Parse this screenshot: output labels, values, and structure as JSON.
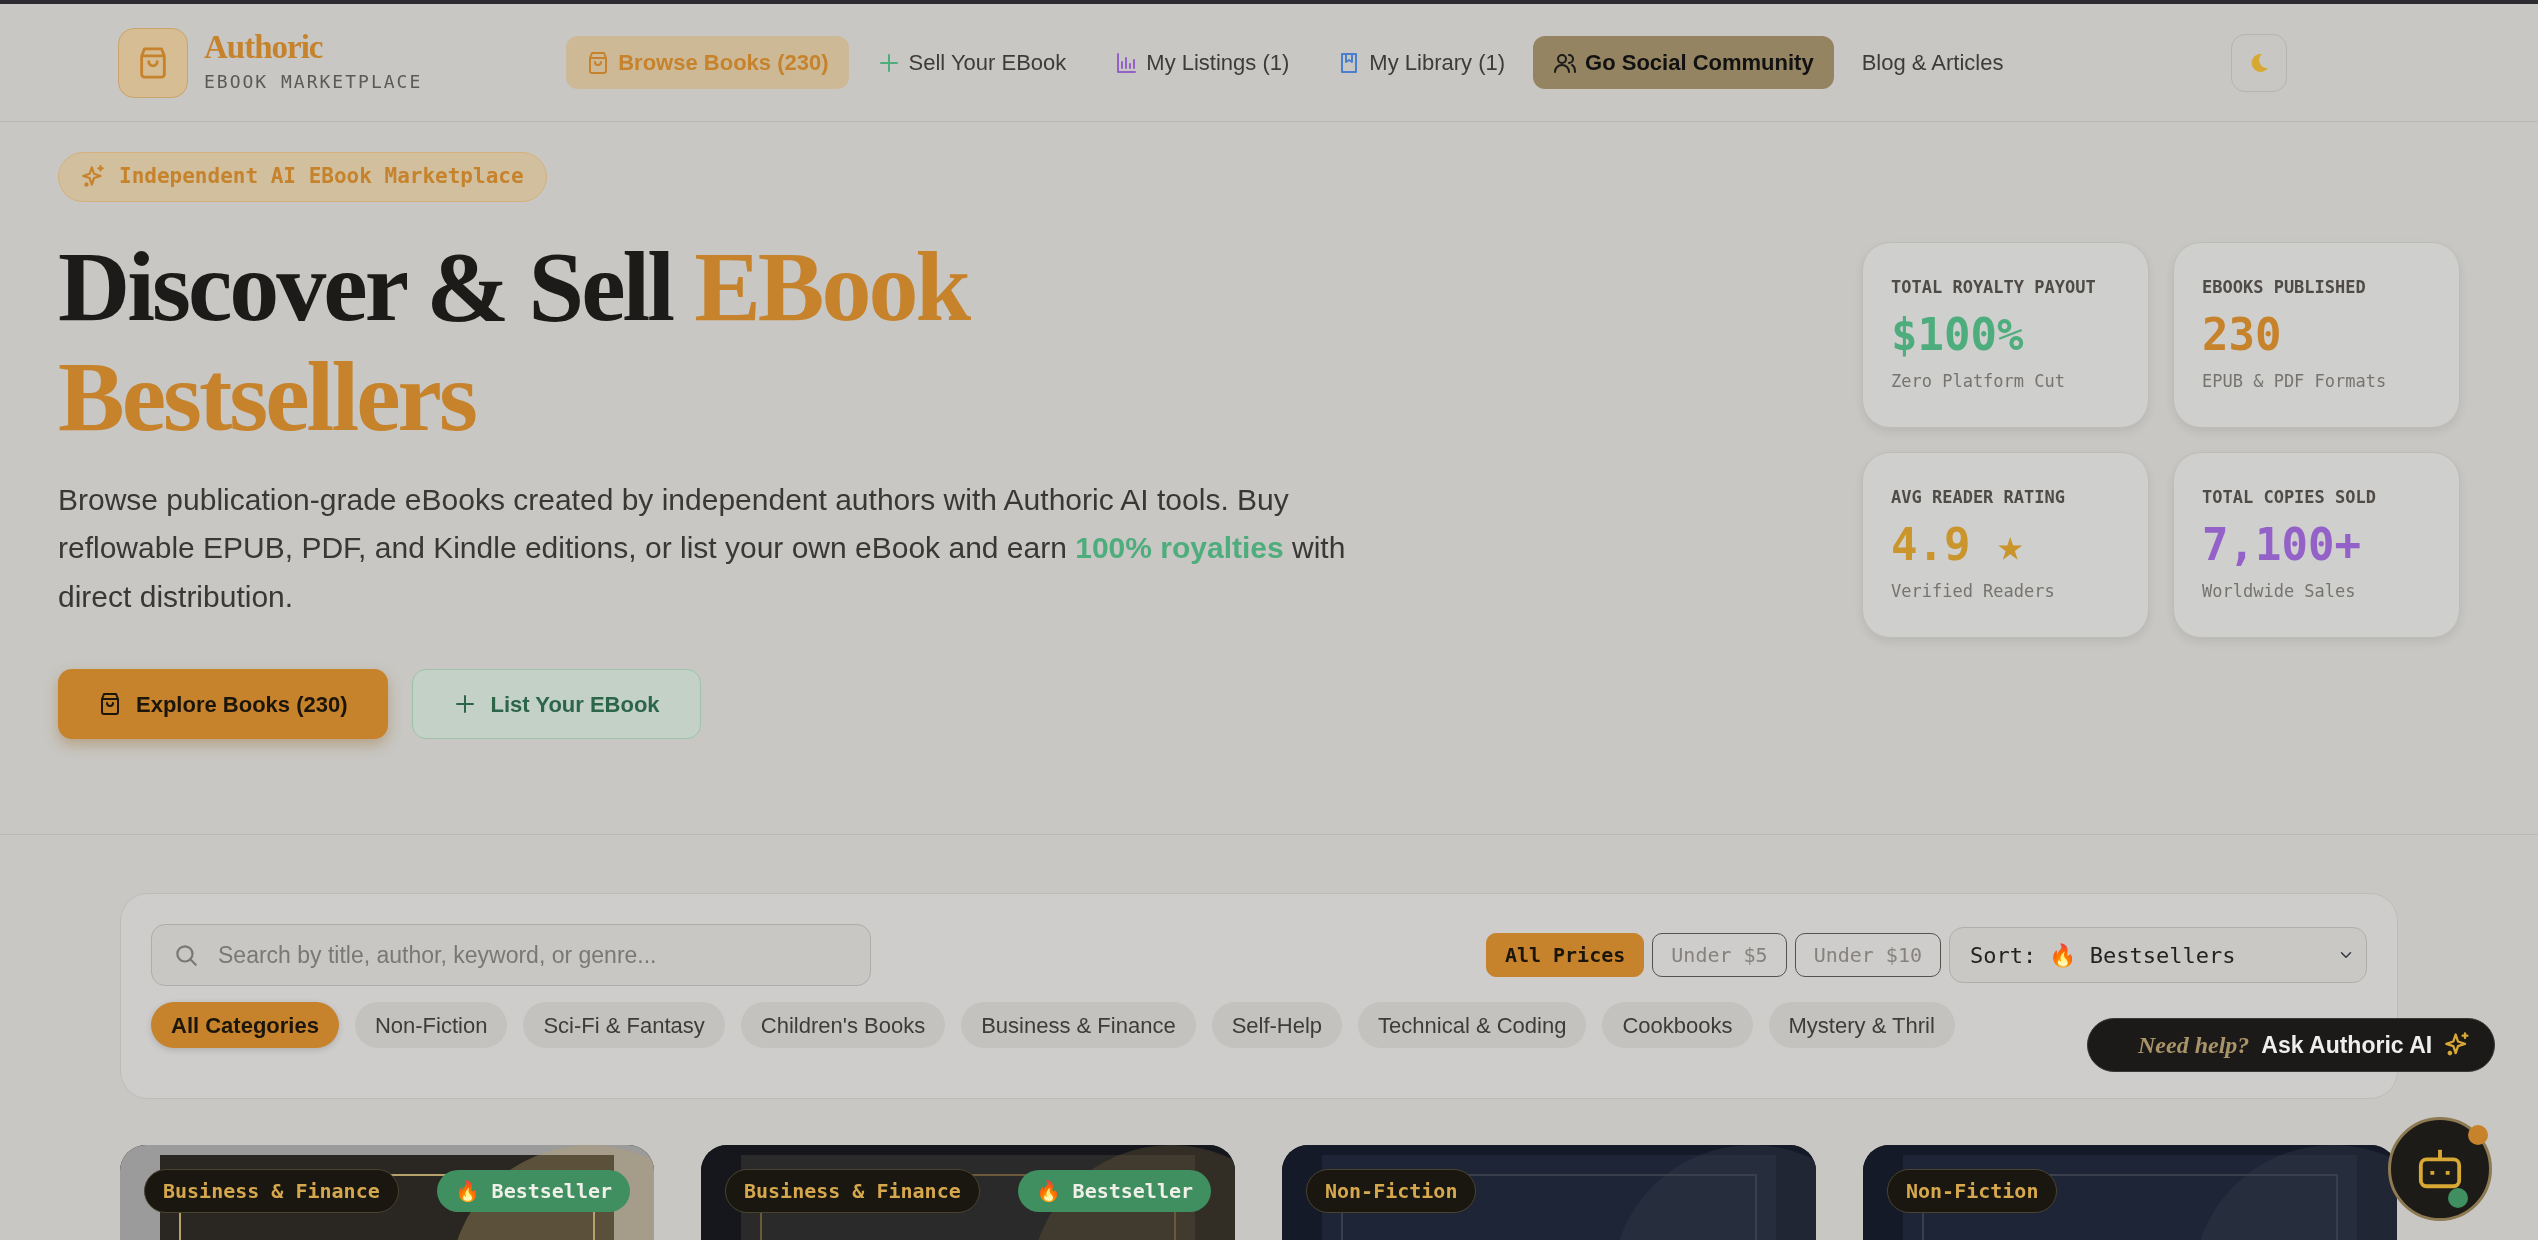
{
  "nav": {
    "brand": {
      "title": "Authoric",
      "subtitle": "EBOOK MARKETPLACE"
    },
    "links": [
      {
        "label": "Browse Books (230)",
        "kind": "link",
        "selected": true
      },
      {
        "label": "Sell Your EBook",
        "kind": "link",
        "selected": false
      },
      {
        "label": "My Listings (1)",
        "kind": "link",
        "selected": false
      },
      {
        "label": "My Library (1)",
        "kind": "link",
        "selected": false
      },
      {
        "label": "Go Social Community",
        "kind": "featured",
        "selected": false
      },
      {
        "label": "Blog & Articles",
        "kind": "link",
        "selected": false
      }
    ]
  },
  "hero": {
    "badge": "Independent AI EBook Marketplace",
    "headline": "Discover & Sell",
    "headline_accent": "EBook Bestsellers",
    "text": "Browse publication-grade eBooks created by independent authors with Authoric AI tools. Buy reflowable EPUB, PDF, and Kindle editions, or list your own eBook and earn **100% royalties** with direct distribution.",
    "buttons": [
      {
        "label": "Explore Books (230)",
        "kind": "primary"
      },
      {
        "label": "List Your EBook",
        "kind": "outline"
      }
    ],
    "stats": [
      {
        "label": "TOTAL ROYALTY PAYOUT",
        "value": "$100%",
        "caption": "Zero Platform Cut",
        "color": "#4ead7c"
      },
      {
        "label": "EBOOKS PUBLISHED",
        "value": "230",
        "caption": "EPUB & PDF Formats",
        "color": "#c6832c"
      },
      {
        "label": "AVG READER RATING",
        "value": "4.9 ★",
        "caption": "Verified Readers",
        "color": "#c9952c"
      },
      {
        "label": "TOTAL COPIES SOLD",
        "value": "7,100+",
        "caption": "Worldwide Sales",
        "color": "#9461c9"
      }
    ]
  },
  "filters": {
    "search": {
      "placeholder": "Search by title, author, keyword, or genre..."
    },
    "prices": [
      {
        "label": "All Prices",
        "selected": true
      },
      {
        "label": "Under $5",
        "selected": false
      },
      {
        "label": "Under $10",
        "selected": false
      }
    ],
    "sort": "Sort: 🔥 Bestsellers",
    "categories": [
      {
        "label": "All Categories",
        "selected": true
      },
      {
        "label": "Non-Fiction",
        "selected": false
      },
      {
        "label": "Sci-Fi & Fantasy",
        "selected": false
      },
      {
        "label": "Children's Books",
        "selected": false
      },
      {
        "label": "Business & Finance",
        "selected": false
      },
      {
        "label": "Self-Help",
        "selected": false
      },
      {
        "label": "Technical & Coding",
        "selected": false
      },
      {
        "label": "Cookbooks",
        "selected": false
      },
      {
        "label": "Mystery & Thril",
        "selected": false
      }
    ]
  },
  "help": {
    "prompt": "Need help?",
    "label": "Ask Authoric AI"
  },
  "books": [
    {
      "badges": [
        {
          "label": "Business & Finance",
          "kind": "category"
        },
        {
          "label": "🔥 Bestseller",
          "kind": "bestseller"
        }
      ]
    },
    {
      "badges": [
        {
          "label": "Business & Finance",
          "kind": "category"
        },
        {
          "label": "🔥 Bestseller",
          "kind": "bestseller"
        }
      ]
    },
    {
      "badges": [
        {
          "label": "Non-Fiction",
          "kind": "category"
        }
      ]
    },
    {
      "badges": [
        {
          "label": "Non-Fiction",
          "kind": "category"
        }
      ]
    }
  ]
}
